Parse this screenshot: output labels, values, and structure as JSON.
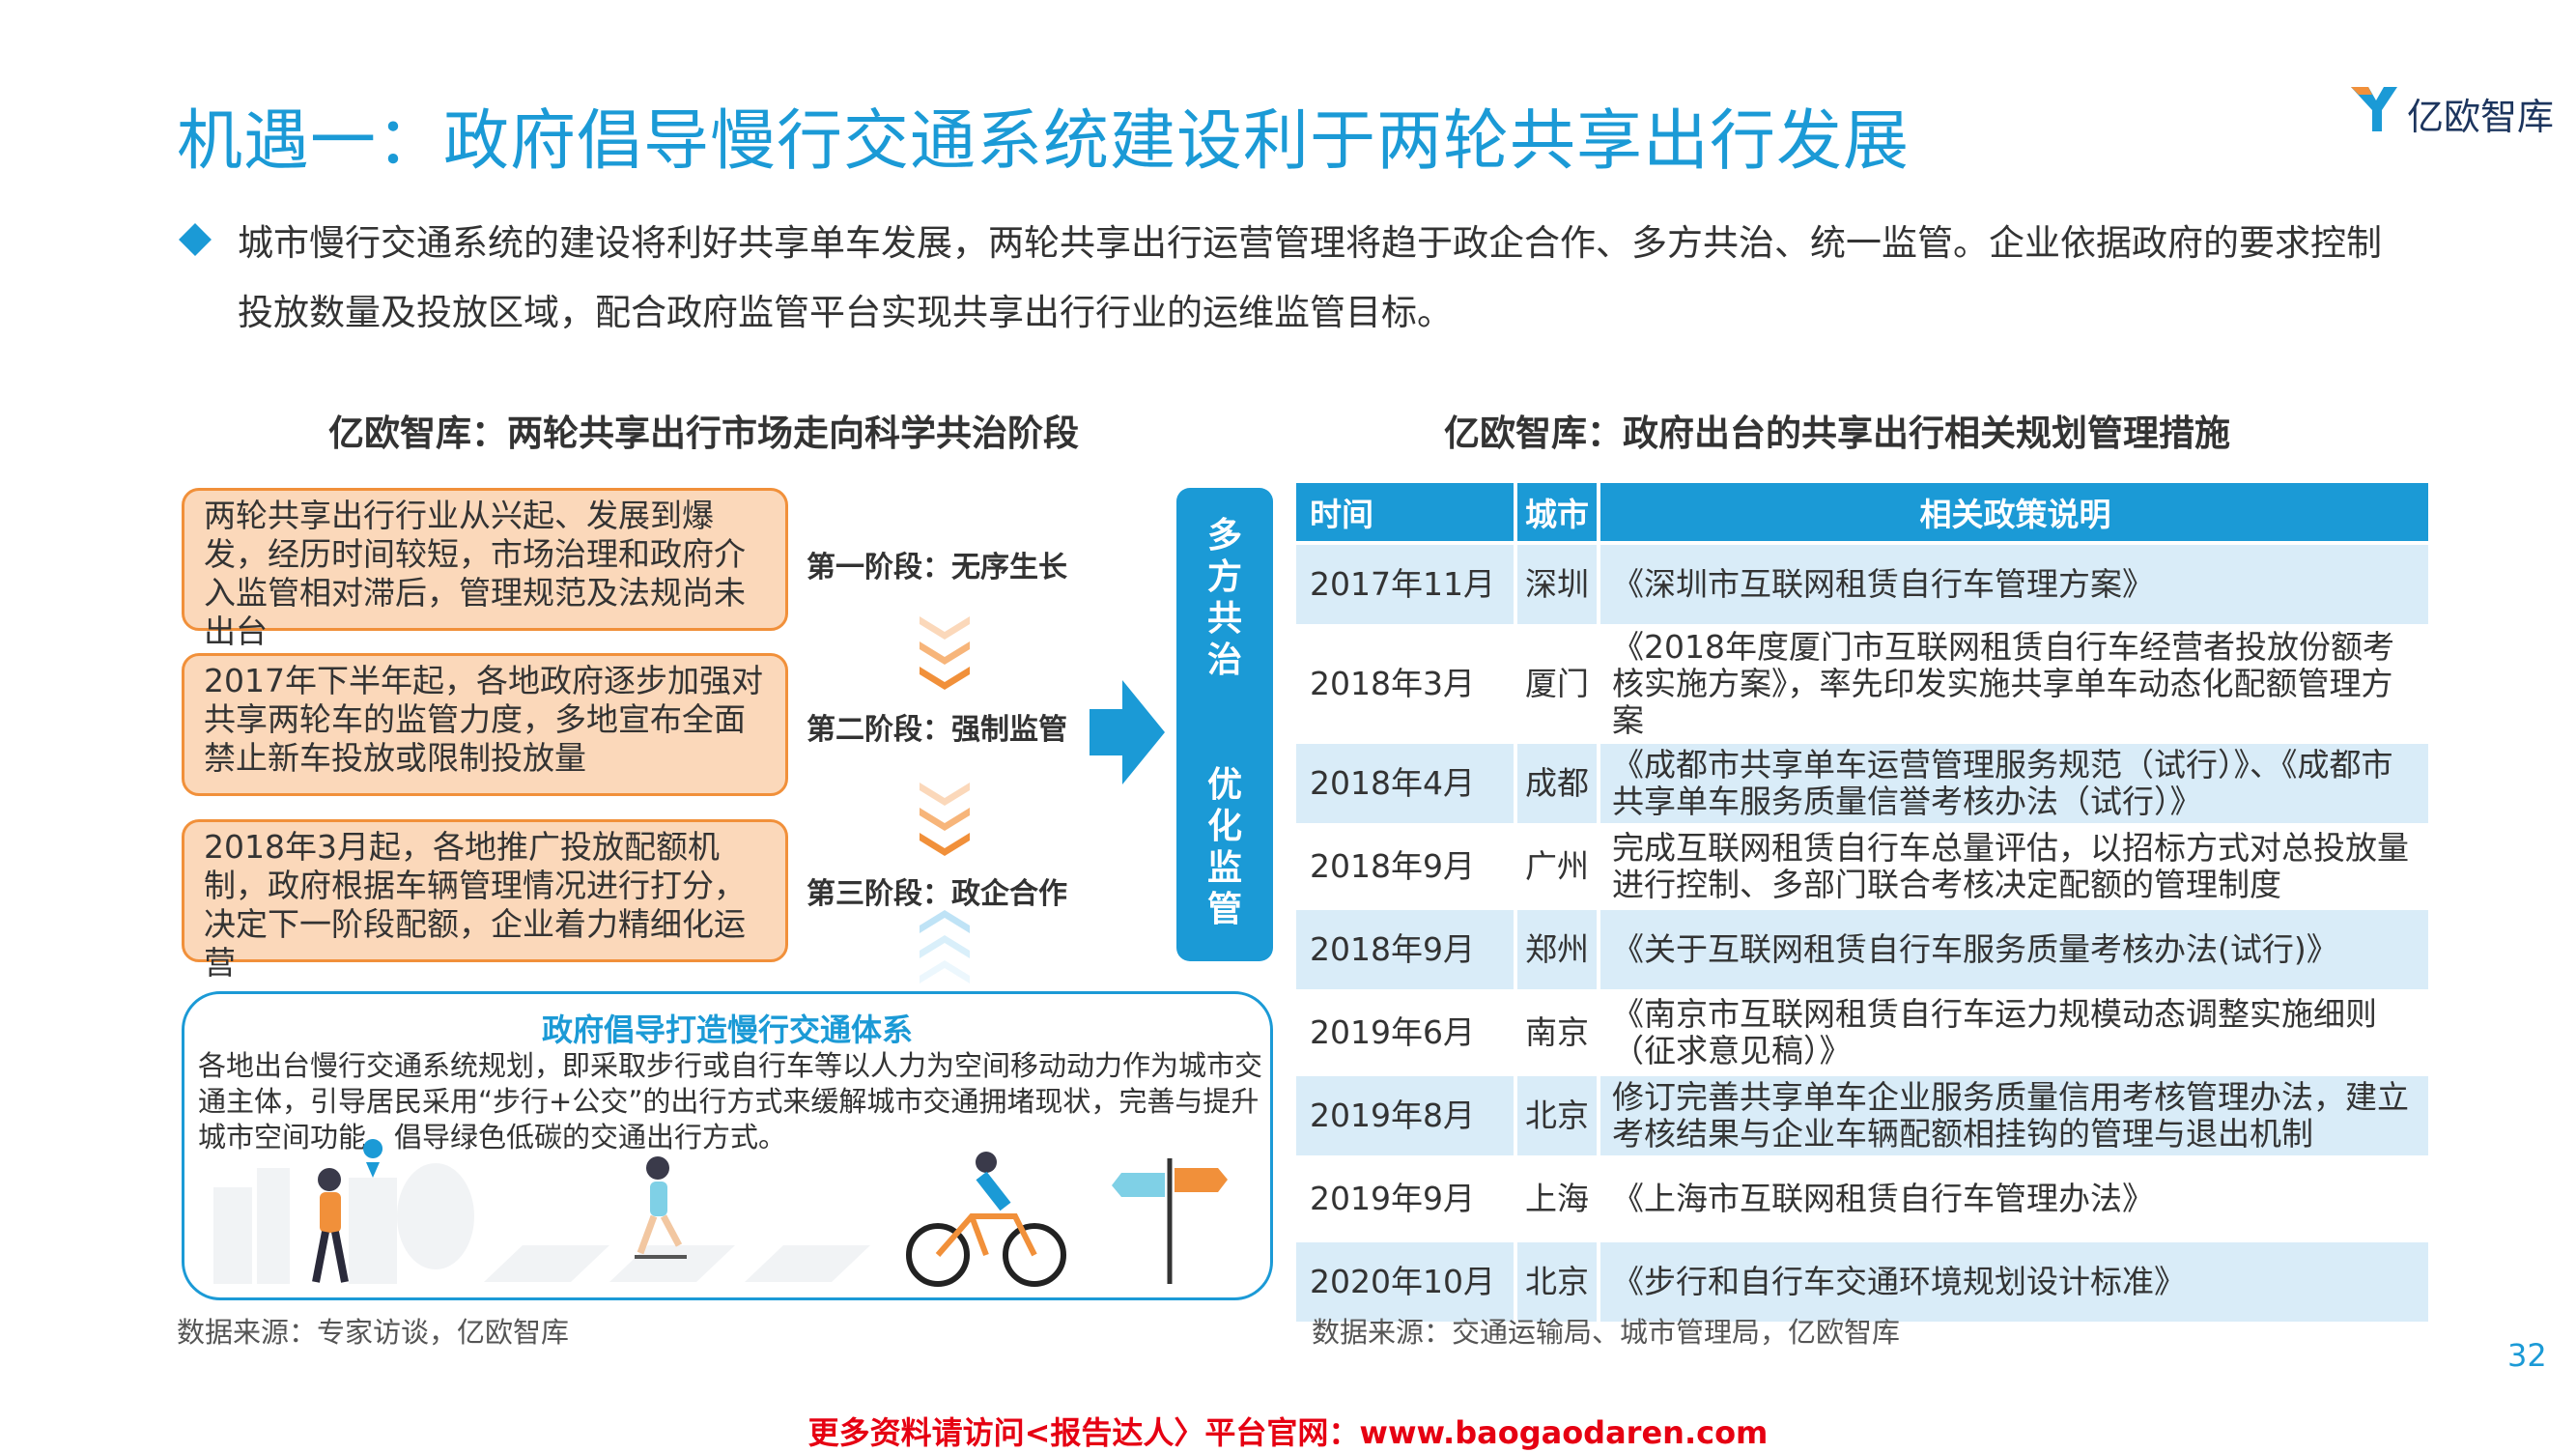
{
  "header": {
    "title": "机遇一：政府倡导慢行交通系统建设利于两轮共享出行发展",
    "logo_text": "亿欧智库"
  },
  "intro": "城市慢行交通系统的建设将利好共享单车发展，两轮共享出行运营管理将趋于政企合作、多方共治、统一监管。企业依据政府的要求控制投放数量及投放区域，配合政府监管平台实现共享出行行业的运维监管目标。",
  "left": {
    "heading": "亿欧智库：两轮共享出行市场走向科学共治阶段",
    "stages": [
      {
        "text": "两轮共享出行行业从兴起、发展到爆发，经历时间较短，市场治理和政府介入监管相对滞后，管理规范及法规尚未出台",
        "label": "第一阶段：无序生长"
      },
      {
        "text": "2017年下半年起，各地政府逐步加强对共享两轮车的监管力度，多地宣布全面禁止新车投放或限制投放量",
        "label": "第二阶段：强制监管"
      },
      {
        "text": "2018年3月起，各地推广投放配额机制，政府根据车辆管理情况进行打分，决定下一阶段配额，企业着力精细化运营",
        "label": "第三阶段：政企合作"
      }
    ],
    "dual_top": [
      "多",
      "方",
      "共",
      "治"
    ],
    "dual_bottom": [
      "优",
      "化",
      "监",
      "管"
    ],
    "bottom_title": "政府倡导打造慢行交通体系",
    "bottom_text": "各地出台慢行交通系统规划，即采取步行或自行车等以人力为空间移动动力作为城市交通主体，引导居民采用“步行+公交”的出行方式来缓解城市交通拥堵现状，完善与提升城市空间功能，倡导绿色低碳的交通出行方式。",
    "source": "数据来源：专家访谈，亿欧智库"
  },
  "right": {
    "heading": "亿欧智库：政府出台的共享出行相关规划管理措施",
    "columns": [
      "时间",
      "城市",
      "相关政策说明"
    ],
    "rows": [
      [
        "2017年11月",
        "深圳",
        "《深圳市互联网租赁自行车管理方案》"
      ],
      [
        "2018年3月",
        "厦门",
        "《2018年度厦门市互联网租赁自行车经营者投放份额考核实施方案》，率先印发实施共享单车动态化配额管理方案"
      ],
      [
        "2018年4月",
        "成都",
        "《成都市共享单车运营管理服务规范（试行）》、《成都市共享单车服务质量信誉考核办法（试行）》"
      ],
      [
        "2018年9月",
        "广州",
        "完成互联网租赁自行车总量评估，以招标方式对总投放量进行控制、多部门联合考核决定配额的管理制度"
      ],
      [
        "2018年9月",
        "郑州",
        "《关于互联网租赁自行车服务质量考核办法(试行)》"
      ],
      [
        "2019年6月",
        "南京",
        "《南京市互联网租赁自行车运力规模动态调整实施细则（征求意见稿）》"
      ],
      [
        "2019年8月",
        "北京",
        "修订完善共享单车企业服务质量信用考核管理办法，建立考核结果与企业车辆配额相挂钩的管理与退出机制"
      ],
      [
        "2019年9月",
        "上海",
        "《上海市互联网租赁自行车管理办法》"
      ],
      [
        "2020年10月",
        "北京",
        "《步行和自行车交通环境规划设计标准》"
      ]
    ],
    "source": "数据来源：交通运输局、城市管理局，亿欧智库"
  },
  "page_number": "32",
  "footer": "更多资料请访问<报告达人〉平台官网：www.baogaodaren.com",
  "colors": {
    "accent": "#1b9ad6",
    "orange": "#f1903a",
    "orange_fill": "#fbd8ba",
    "row_tint": "#d9ecf8",
    "footer_red": "#e60012"
  }
}
